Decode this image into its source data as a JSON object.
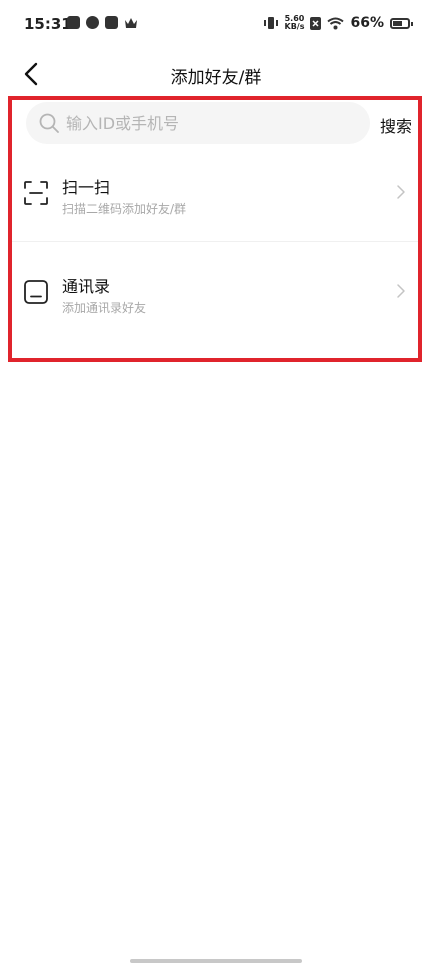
{
  "status_bar": {
    "time": "15:31",
    "netspeed_value": "5.60",
    "netspeed_unit": "KB/s",
    "battery": "66%",
    "battery_level": 0.66,
    "icons": [
      "message-icon",
      "app-icon",
      "tiktok-icon",
      "crown-icon",
      "vibrate-icon",
      "sim-off-icon",
      "wifi-icon",
      "battery-icon"
    ]
  },
  "header": {
    "title": "添加好友/群",
    "back_icon": "chevron-left-icon"
  },
  "search": {
    "placeholder": "输入ID或手机号",
    "value": "",
    "button_label": "搜索",
    "icon": "search-icon"
  },
  "items": [
    {
      "title": "扫一扫",
      "subtitle": "扫描二维码添加好友/群",
      "icon": "scan-icon"
    },
    {
      "title": "通讯录",
      "subtitle": "添加通讯录好友",
      "icon": "contacts-icon"
    }
  ],
  "colors": {
    "highlight_border": "#e0242c",
    "search_bg": "#f5f5f5",
    "subtitle": "#a8a8a8"
  }
}
